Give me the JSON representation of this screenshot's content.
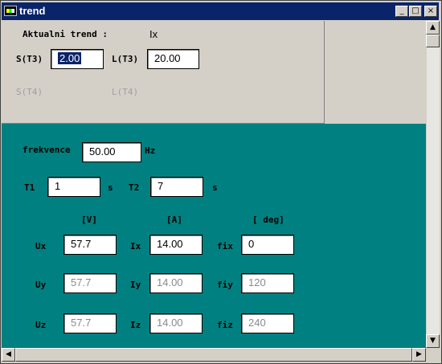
{
  "window": {
    "title": "trend"
  },
  "titlebar_buttons": {
    "minimize": "_",
    "maximize": "□",
    "close": "×"
  },
  "top": {
    "aktualni_label": "Aktualni trend :",
    "aktualni_value": "Ix",
    "s_t3_label": "S(T3)",
    "s_t3_value": "2.00",
    "l_t3_label": "L(T3)",
    "l_t3_value": "20.00",
    "s_t4_label": "S(T4)",
    "l_t4_label": "L(T4)"
  },
  "main": {
    "frekvence_label": "frekvence",
    "frekvence_value": "50.00",
    "frekvence_unit": "Hz",
    "t1_label": "T1",
    "t1_value": "1",
    "t1_unit": "s",
    "t2_label": "T2",
    "t2_value": "7",
    "t2_unit": "s",
    "col_v": "[V]",
    "col_a": "[A]",
    "col_deg": "[ deg]",
    "rows": [
      {
        "u_label": "Ux",
        "u_value": "57.7",
        "i_label": "Ix",
        "i_value": "14.00",
        "f_label": "fix",
        "f_value": "0"
      },
      {
        "u_label": "Uy",
        "u_value": "57.7",
        "i_label": "Iy",
        "i_value": "14.00",
        "f_label": "fiy",
        "f_value": "120"
      },
      {
        "u_label": "Uz",
        "u_value": "57.7",
        "i_label": "Iz",
        "i_value": "14.00",
        "f_label": "fiz",
        "f_value": "240"
      }
    ]
  },
  "scroll": {
    "up": "▲",
    "down": "▼",
    "left": "◀",
    "right": "▶"
  }
}
